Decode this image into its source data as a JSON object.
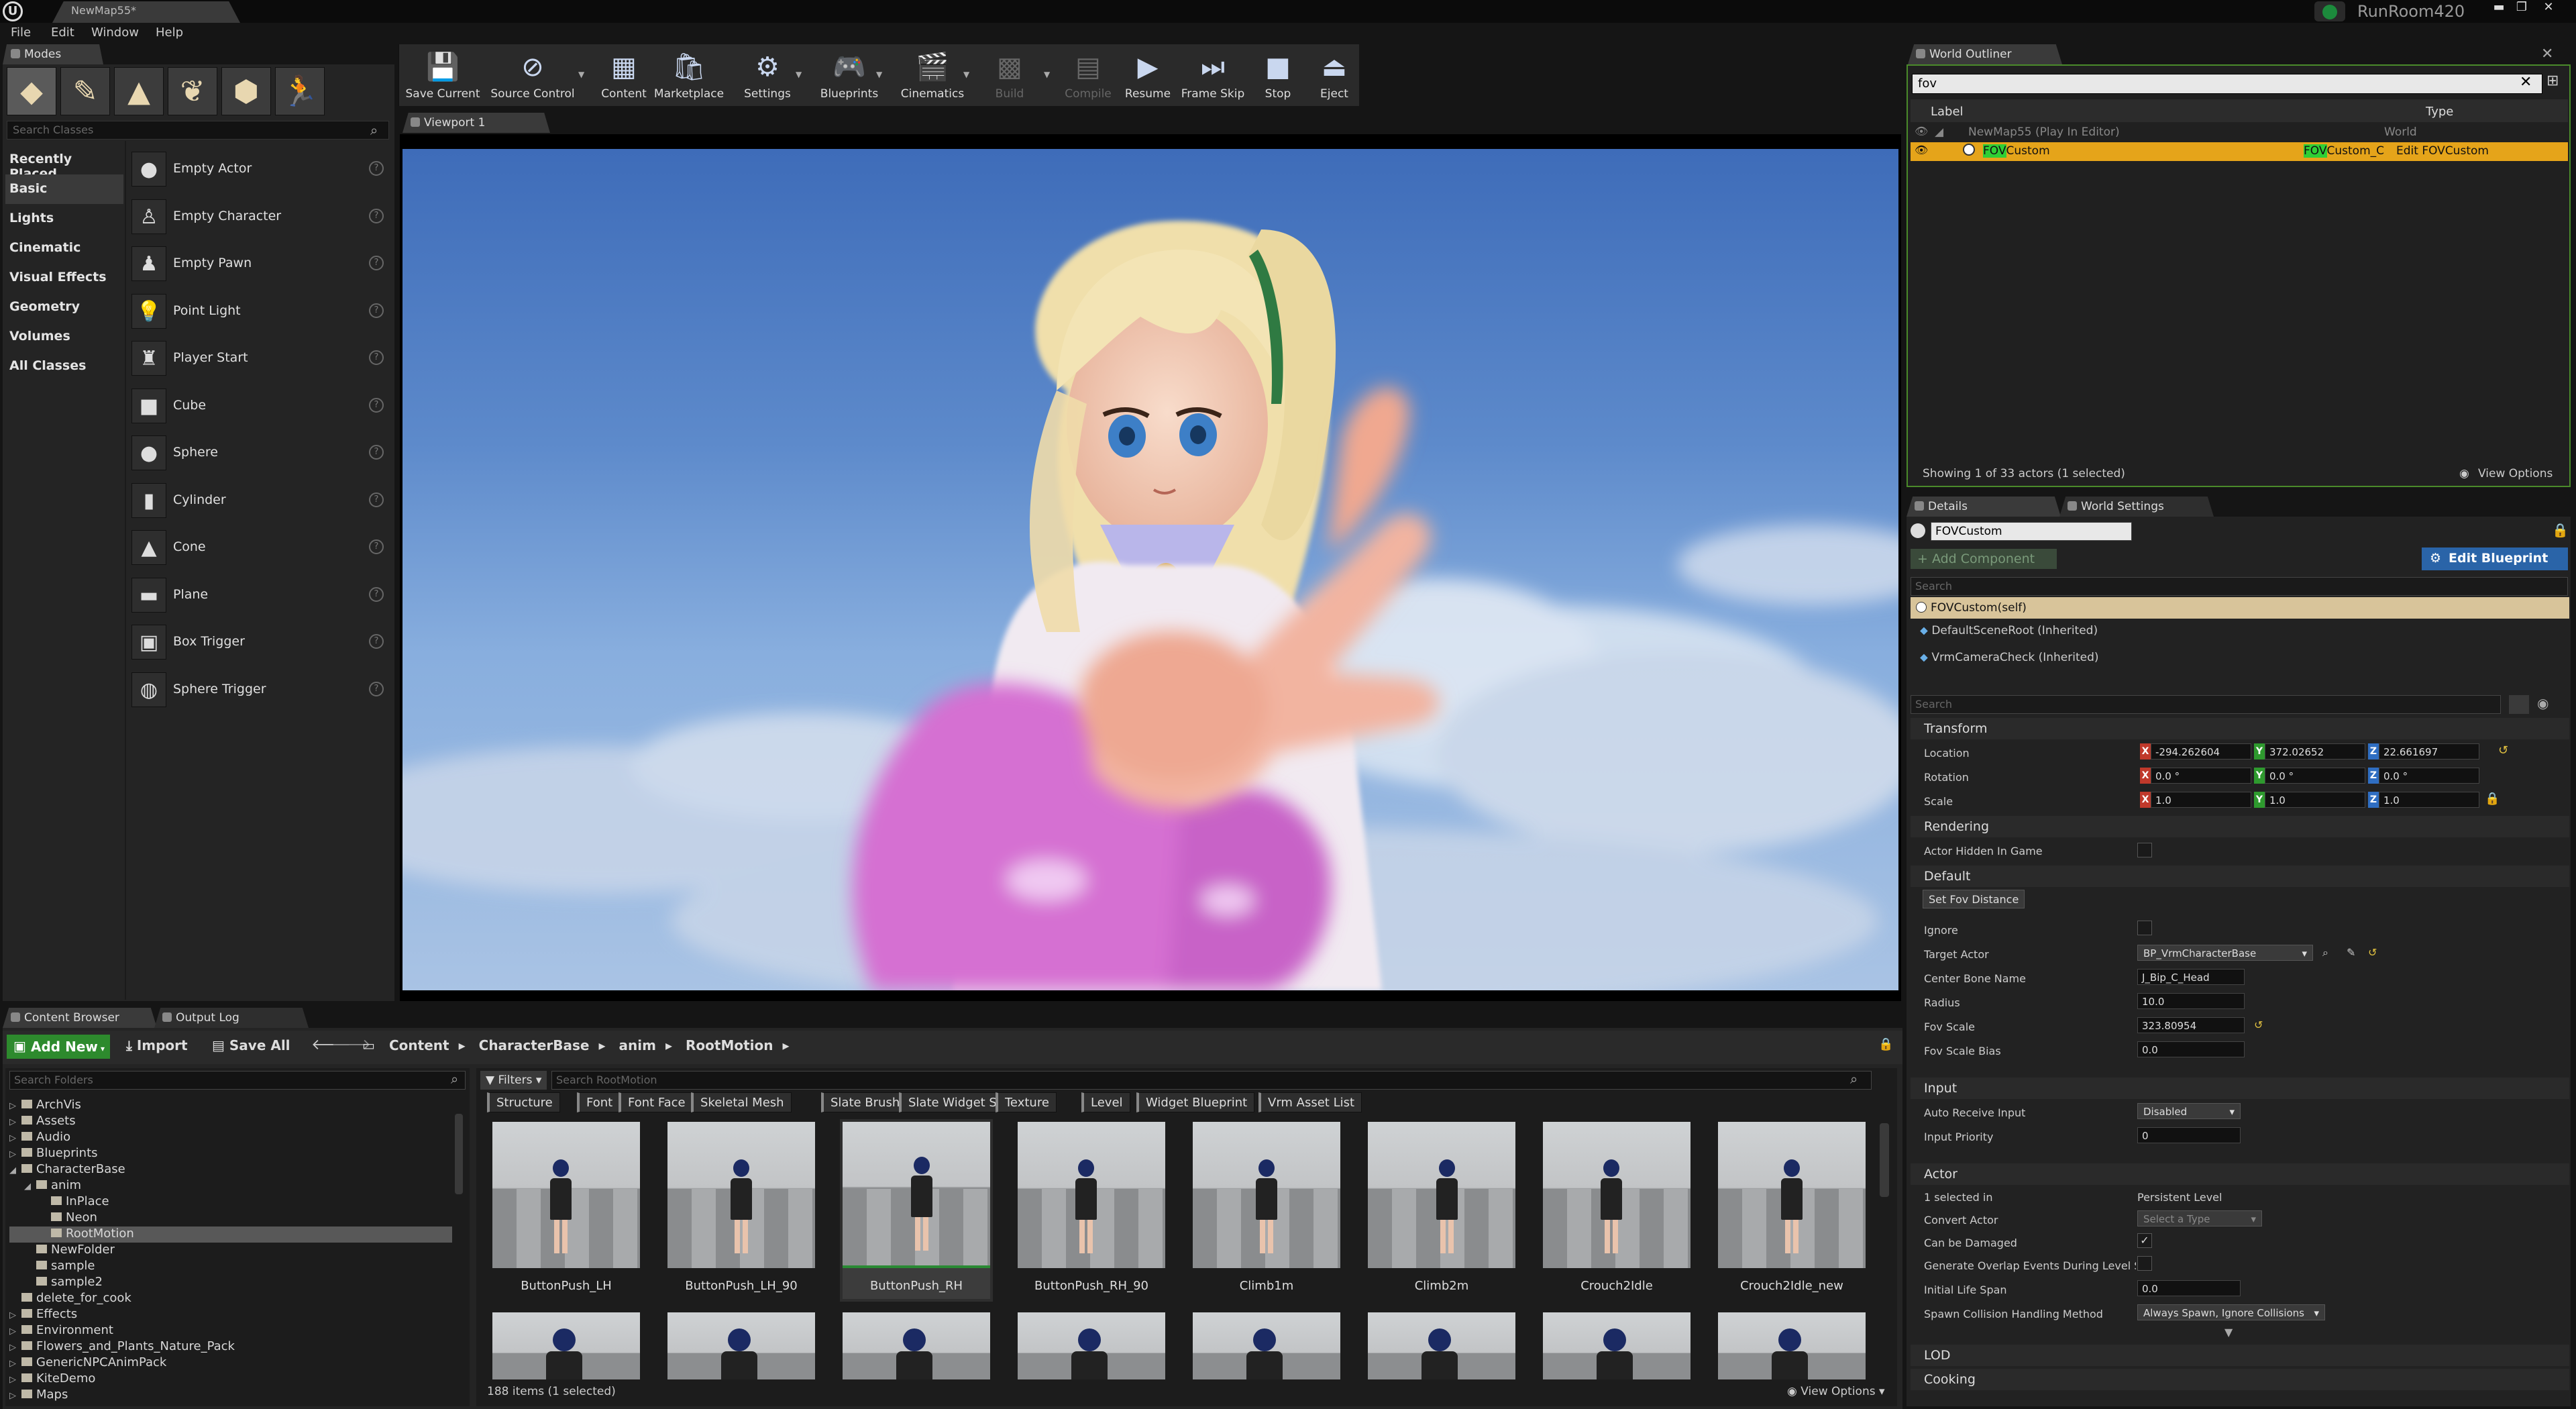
{
  "window": {
    "tab_title": "NewMap55*",
    "project_name": "RunRoom420",
    "min": "▬",
    "max": "❐",
    "close": "✕"
  },
  "menu": [
    "File",
    "Edit",
    "Window",
    "Help"
  ],
  "modes": {
    "tab": "Modes",
    "search_placeholder": "Search Classes",
    "categories": [
      "Recently Placed",
      "Basic",
      "Lights",
      "Cinematic",
      "Visual Effects",
      "Geometry",
      "Volumes",
      "All Classes"
    ],
    "items": [
      {
        "label": "Empty Actor",
        "icon": "sphere-icon",
        "glyph": "●"
      },
      {
        "label": "Empty Character",
        "icon": "character-icon",
        "glyph": "♙"
      },
      {
        "label": "Empty Pawn",
        "icon": "pawn-icon",
        "glyph": "♟"
      },
      {
        "label": "Point Light",
        "icon": "bulb-icon",
        "glyph": "💡"
      },
      {
        "label": "Player Start",
        "icon": "player-start-icon",
        "glyph": "♜"
      },
      {
        "label": "Cube",
        "icon": "cube-icon",
        "glyph": "■"
      },
      {
        "label": "Sphere",
        "icon": "sphere-icon",
        "glyph": "●"
      },
      {
        "label": "Cylinder",
        "icon": "cylinder-icon",
        "glyph": "▮"
      },
      {
        "label": "Cone",
        "icon": "cone-icon",
        "glyph": "▲"
      },
      {
        "label": "Plane",
        "icon": "plane-icon",
        "glyph": "▬"
      },
      {
        "label": "Box Trigger",
        "icon": "box-trigger-icon",
        "glyph": "▣"
      },
      {
        "label": "Sphere Trigger",
        "icon": "sphere-trigger-icon",
        "glyph": "◍"
      }
    ]
  },
  "toolbar": {
    "buttons": [
      {
        "label": "Save Current",
        "icon": "save-icon",
        "glyph": "💾",
        "enabled": true
      },
      {
        "label": "Source Control",
        "icon": "source-control-icon",
        "glyph": "⊘",
        "enabled": true
      },
      {
        "label": "Content",
        "icon": "content-icon",
        "glyph": "▦",
        "enabled": true
      },
      {
        "label": "Marketplace",
        "icon": "marketplace-icon",
        "glyph": "🛍",
        "enabled": true
      },
      {
        "label": "Settings",
        "icon": "settings-icon",
        "glyph": "⚙",
        "enabled": true
      },
      {
        "label": "Blueprints",
        "icon": "blueprints-icon",
        "glyph": "🎮",
        "enabled": true
      },
      {
        "label": "Cinematics",
        "icon": "cinematics-icon",
        "glyph": "🎬",
        "enabled": true
      },
      {
        "label": "Build",
        "icon": "build-icon",
        "glyph": "▩",
        "enabled": false
      },
      {
        "label": "Compile",
        "icon": "compile-icon",
        "glyph": "▤",
        "enabled": false
      },
      {
        "label": "Resume",
        "icon": "resume-icon",
        "glyph": "▶",
        "enabled": true
      },
      {
        "label": "Frame Skip",
        "icon": "frame-skip-icon",
        "glyph": "⏭",
        "enabled": true
      },
      {
        "label": "Stop",
        "icon": "stop-icon",
        "glyph": "■",
        "enabled": true
      },
      {
        "label": "Eject",
        "icon": "eject-icon",
        "glyph": "⏏",
        "enabled": true
      }
    ]
  },
  "viewport": {
    "tab": "Viewport 1"
  },
  "outliner": {
    "tab": "World Outliner",
    "search_value": "fov",
    "columns": {
      "label": "Label",
      "type": "Type"
    },
    "rows": [
      {
        "label": "NewMap55 (Play In Editor)",
        "type": "World"
      },
      {
        "label_highlight": "FOV",
        "label_rest": "Custom",
        "type_highlight": "FOV",
        "type_rest": "Custom_C",
        "action": "Edit FOVCustom"
      }
    ],
    "footer": "Showing 1 of 33 actors (1 selected)",
    "view_options": "View Options"
  },
  "details": {
    "tab": "Details",
    "tab2": "World Settings",
    "actor_name": "FOVCustom",
    "add_component": "+ Add Component",
    "edit_blueprint": "Edit Blueprint",
    "search1": "Search",
    "components": [
      "FOVCustom(self)",
      "DefaultSceneRoot (Inherited)",
      "VrmCameraCheck (Inherited)"
    ],
    "search2": "Search",
    "transform": {
      "title": "Transform",
      "location_label": "Location",
      "rotation_label": "Rotation",
      "scale_label": "Scale",
      "location": [
        "-294.262604",
        "372.02652",
        "22.661697"
      ],
      "rotation": [
        "0.0 °",
        "0.0 °",
        "0.0 °"
      ],
      "scale": [
        "1.0",
        "1.0",
        "1.0"
      ]
    },
    "rendering": {
      "title": "Rendering",
      "hidden_label": "Actor Hidden In Game"
    },
    "default": {
      "title": "Default",
      "button": "Set Fov Distance",
      "ignore_label": "Ignore",
      "target_actor_label": "Target Actor",
      "target_actor_value": "BP_VrmCharacterBase",
      "bone_label": "Center Bone Name",
      "bone_value": "J_Bip_C_Head",
      "radius_label": "Radius",
      "radius_value": "10.0",
      "fov_scale_label": "Fov Scale",
      "fov_scale_value": "323.80954",
      "fov_bias_label": "Fov Scale Bias",
      "fov_bias_value": "0.0"
    },
    "input": {
      "title": "Input",
      "auto_label": "Auto Receive Input",
      "auto_value": "Disabled",
      "priority_label": "Input Priority",
      "priority_value": "0"
    },
    "actor": {
      "title": "Actor",
      "selected_label": "1 selected in",
      "selected_value": "Persistent Level",
      "convert_label": "Convert Actor",
      "convert_value": "Select a Type",
      "damage_label": "Can be Damaged",
      "overlap_label": "Generate Overlap Events During Level Str",
      "life_label": "Initial Life Span",
      "life_value": "0.0",
      "spawn_label": "Spawn Collision Handling Method",
      "spawn_value": "Always Spawn, Ignore Collisions"
    },
    "lod": "LOD",
    "cooking": "Cooking"
  },
  "content_browser": {
    "tab": "Content Browser",
    "tab2": "Output Log",
    "add_new": "Add New",
    "import": "Import",
    "save_all": "Save All",
    "breadcrumb": [
      "Content",
      "CharacterBase",
      "anim",
      "RootMotion"
    ],
    "search_folders": "Search Folders",
    "filters": "Filters",
    "search_assets": "Search RootMotion",
    "filter_tags": [
      "Structure",
      "Font",
      "Font Face",
      "Skeletal Mesh",
      "Slate Brush",
      "Slate Widget Style",
      "Texture",
      "Level",
      "Widget Blueprint",
      "Vrm Asset List"
    ],
    "folders": [
      {
        "name": "ArchVis",
        "depth": 0,
        "arrow": "▷"
      },
      {
        "name": "Assets",
        "depth": 0,
        "arrow": "▷"
      },
      {
        "name": "Audio",
        "depth": 0,
        "arrow": "▷"
      },
      {
        "name": "Blueprints",
        "depth": 0,
        "arrow": "▷"
      },
      {
        "name": "CharacterBase",
        "depth": 0,
        "arrow": "◢"
      },
      {
        "name": "anim",
        "depth": 1,
        "arrow": "◢"
      },
      {
        "name": "InPlace",
        "depth": 2,
        "arrow": ""
      },
      {
        "name": "Neon",
        "depth": 2,
        "arrow": ""
      },
      {
        "name": "RootMotion",
        "depth": 2,
        "arrow": "",
        "selected": true
      },
      {
        "name": "NewFolder",
        "depth": 1,
        "arrow": ""
      },
      {
        "name": "sample",
        "depth": 1,
        "arrow": ""
      },
      {
        "name": "sample2",
        "depth": 1,
        "arrow": ""
      },
      {
        "name": "delete_for_cook",
        "depth": 0,
        "arrow": ""
      },
      {
        "name": "Effects",
        "depth": 0,
        "arrow": "▷"
      },
      {
        "name": "Environment",
        "depth": 0,
        "arrow": "▷"
      },
      {
        "name": "Flowers_and_Plants_Nature_Pack",
        "depth": 0,
        "arrow": "▷"
      },
      {
        "name": "GenericNPCAnimPack",
        "depth": 0,
        "arrow": "▷"
      },
      {
        "name": "KiteDemo",
        "depth": 0,
        "arrow": "▷"
      },
      {
        "name": "Maps",
        "depth": 0,
        "arrow": "▷"
      }
    ],
    "assets": [
      "ButtonPush_LH",
      "ButtonPush_LH_90",
      "ButtonPush_RH",
      "ButtonPush_RH_90",
      "Climb1m",
      "Climb2m",
      "Crouch2Idle",
      "Crouch2Idle_new"
    ],
    "status": "188 items (1 selected)",
    "view_options": "View Options"
  }
}
